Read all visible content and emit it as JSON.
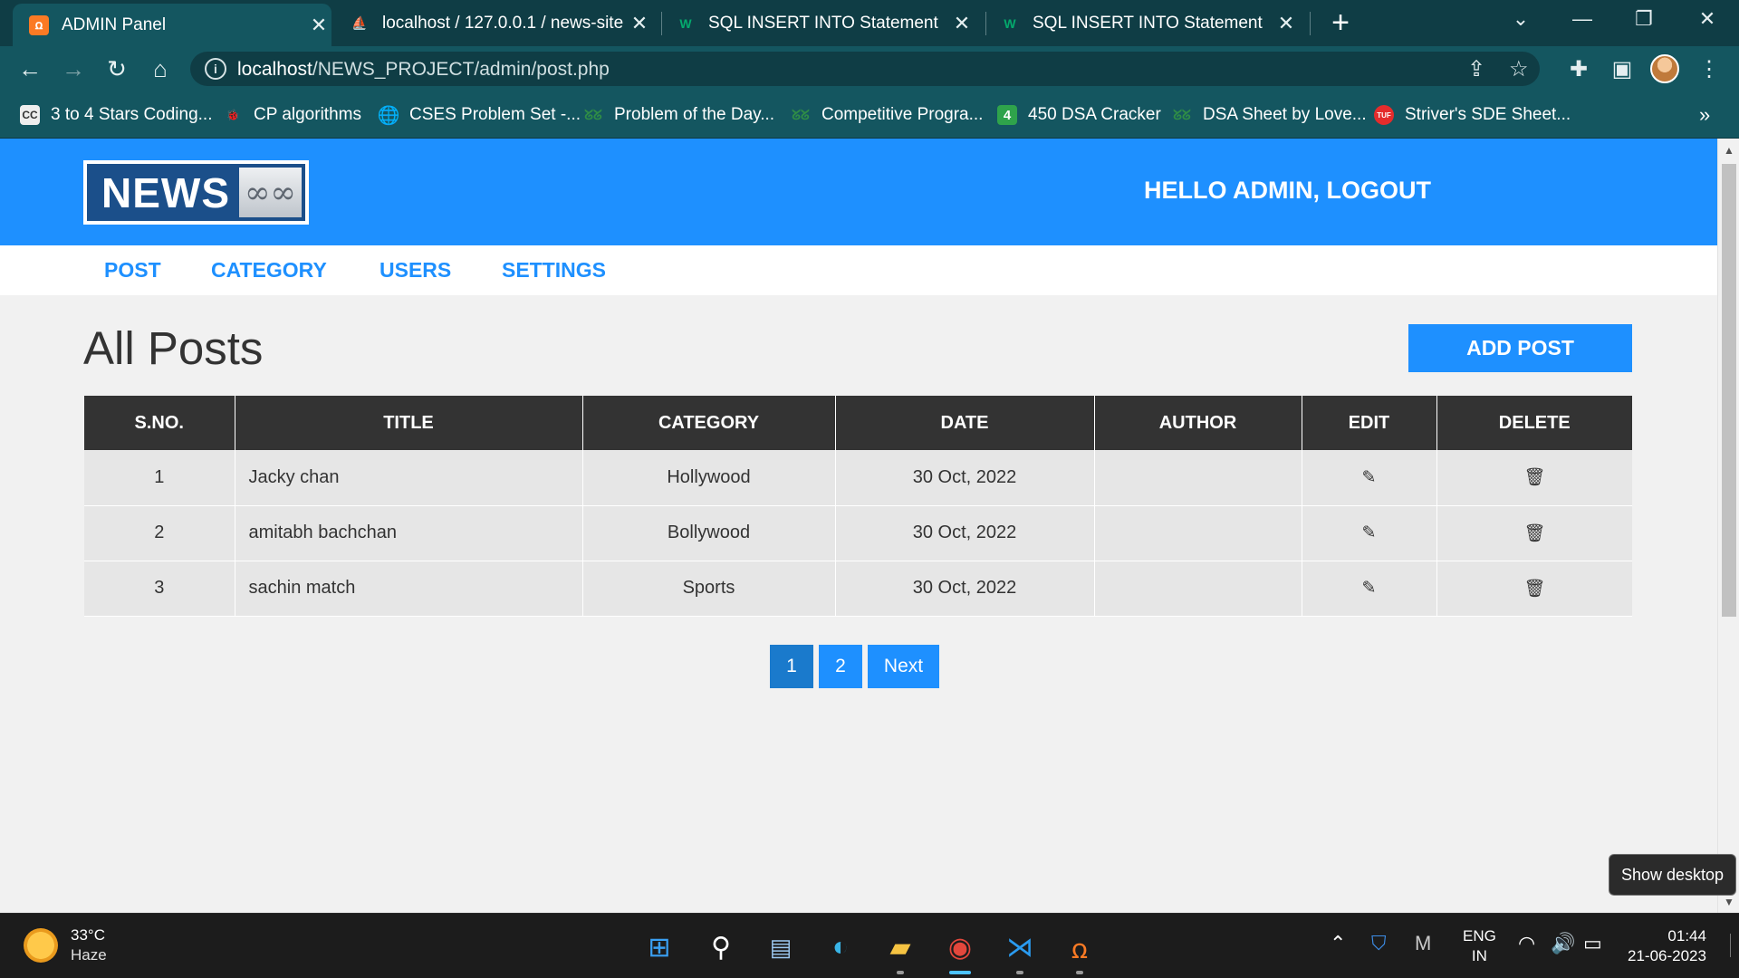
{
  "browser": {
    "tabs": [
      {
        "title": "ADMIN Panel",
        "icon": "xampp-icon"
      },
      {
        "title": "localhost / 127.0.0.1 / news-site / ",
        "icon": "phpmyadmin-icon"
      },
      {
        "title": "SQL INSERT INTO Statement",
        "icon": "w3schools-icon"
      },
      {
        "title": "SQL INSERT INTO Statement",
        "icon": "w3schools-icon"
      }
    ],
    "address": {
      "host": "localhost",
      "path": "/NEWS_PROJECT/admin/post.php"
    },
    "bookmarks": [
      {
        "label": "3 to 4 Stars Coding...",
        "icon": "cc-icon"
      },
      {
        "label": "CP algorithms",
        "icon": "cp-icon"
      },
      {
        "label": "CSES Problem Set -...",
        "icon": "globe-icon"
      },
      {
        "label": "Problem of the Day...",
        "icon": "gfg-icon"
      },
      {
        "label": "Competitive Progra...",
        "icon": "gfg-icon"
      },
      {
        "label": "450 DSA Cracker",
        "icon": "four-icon"
      },
      {
        "label": "DSA Sheet by Love...",
        "icon": "gfg-icon"
      },
      {
        "label": "Striver's SDE Sheet...",
        "icon": "tuf-icon"
      }
    ],
    "accent": "#145660"
  },
  "site": {
    "logo_text": "NEWS",
    "greeting": "HELLO ADMIN, LOGOUT",
    "menu": [
      "POST",
      "CATEGORY",
      "USERS",
      "SETTINGS"
    ],
    "brand_color": "#1e90ff"
  },
  "posts": {
    "title": "All Posts",
    "add_label": "ADD POST",
    "columns": [
      "S.NO.",
      "TITLE",
      "CATEGORY",
      "DATE",
      "AUTHOR",
      "EDIT",
      "DELETE"
    ],
    "rows": [
      {
        "sno": "1",
        "title": "Jacky chan",
        "category": "Hollywood",
        "date": "30 Oct, 2022",
        "author": ""
      },
      {
        "sno": "2",
        "title": "amitabh bachchan",
        "category": "Bollywood",
        "date": "30 Oct, 2022",
        "author": ""
      },
      {
        "sno": "3",
        "title": "sachin match",
        "category": "Sports",
        "date": "30 Oct, 2022",
        "author": ""
      }
    ],
    "pagination": [
      "1",
      "2",
      "Next"
    ],
    "current_page": "1"
  },
  "tooltip": "Show desktop",
  "taskbar": {
    "temp": "33°C",
    "condition": "Haze",
    "lang_top": "ENG",
    "lang_bottom": "IN",
    "time": "01:44",
    "date": "21-06-2023"
  }
}
